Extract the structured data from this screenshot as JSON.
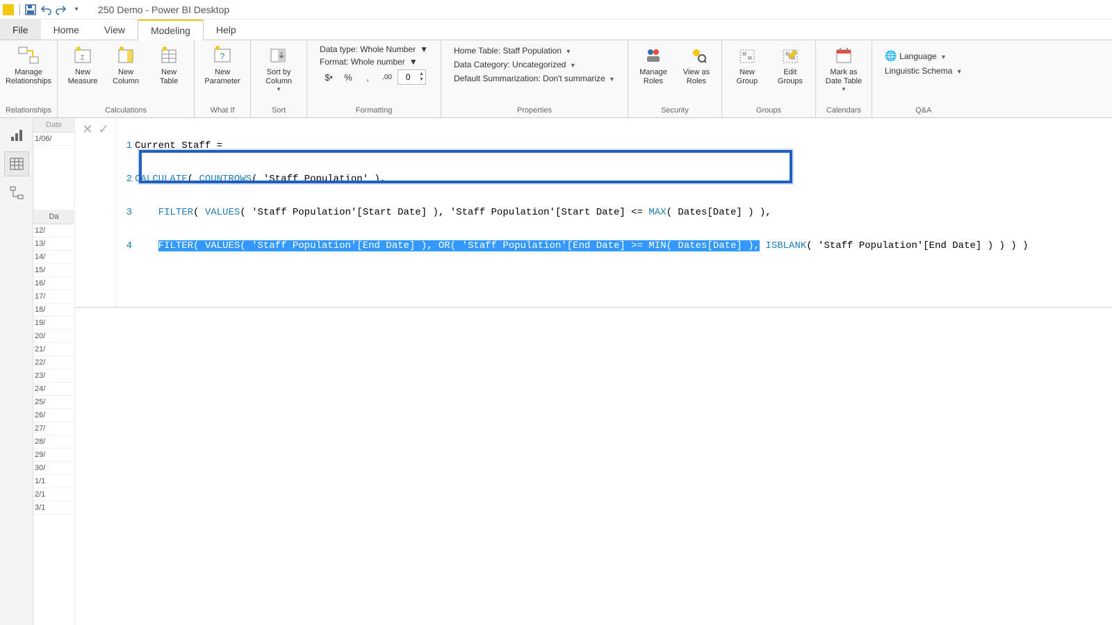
{
  "title": "250 Demo - Power BI Desktop",
  "tabs": {
    "file": "File",
    "home": "Home",
    "view": "View",
    "modeling": "Modeling",
    "help": "Help"
  },
  "ribbon": {
    "relationships": {
      "manage": "Manage\nRelationships",
      "group": "Relationships"
    },
    "calculations": {
      "measure": "New\nMeasure",
      "column": "New\nColumn",
      "table": "New\nTable",
      "group": "Calculations"
    },
    "whatif": {
      "param": "New\nParameter",
      "group": "What If"
    },
    "sort": {
      "sortby": "Sort by\nColumn",
      "group": "Sort"
    },
    "formatting": {
      "datatype": "Data type: Whole Number",
      "format": "Format: Whole number",
      "currency": "$",
      "percent": "%",
      "comma": ",",
      "decimals_label": ".00",
      "decimals_value": "0",
      "group": "Formatting"
    },
    "properties": {
      "hometable": "Home Table: Staff Population",
      "datacat": "Data Category: Uncategorized",
      "summarize": "Default Summarization: Don't summarize",
      "group": "Properties"
    },
    "security": {
      "manage": "Manage\nRoles",
      "viewas": "View as\nRoles",
      "group": "Security"
    },
    "groups": {
      "newg": "New\nGroup",
      "editg": "Edit\nGroups",
      "group": "Groups"
    },
    "calendars": {
      "markas": "Mark as\nDate Table",
      "group": "Calendars"
    },
    "qa": {
      "language": "Language",
      "linguistic": "Linguistic Schema",
      "group": "Q&A"
    }
  },
  "formula": {
    "line1_pre": "Current Staff =",
    "line2_calc": "CALCULATE",
    "line2_count": "COUNTROWS",
    "line2_rest": "( 'Staff Population' ),",
    "line3_filter": "FILTER",
    "line3_values": "VALUES",
    "line3_mid": "( 'Staff Population'[Start Date] ), 'Staff Population'[Start Date] <= ",
    "line3_max": "MAX",
    "line3_end": "( Dates[Date] ) ),",
    "line4_filter": "FILTER",
    "line4_values": "VALUES",
    "line4_seg1": "( 'Staff Population'[End Date] ), ",
    "line4_or": "OR",
    "line4_seg2": "( 'Staff Population'[End Date] >= ",
    "line4_min": "MIN",
    "line4_seg3": "( Dates[Date] ),",
    "line4_isblank": "ISBLANK",
    "line4_seg4": "( 'Staff Population'[End Date] ) ) ) )"
  },
  "grid": {
    "header_top": "Date",
    "row_top": "1/06/",
    "header": "Da",
    "rows": [
      "12/",
      "13/",
      "14/",
      "15/",
      "16/",
      "17/",
      "18/",
      "19/",
      "20/",
      "21/",
      "22/",
      "23/",
      "24/",
      "25/",
      "26/",
      "27/",
      "28/",
      "29/",
      "30/",
      "1/1",
      "2/1",
      "3/1"
    ]
  }
}
